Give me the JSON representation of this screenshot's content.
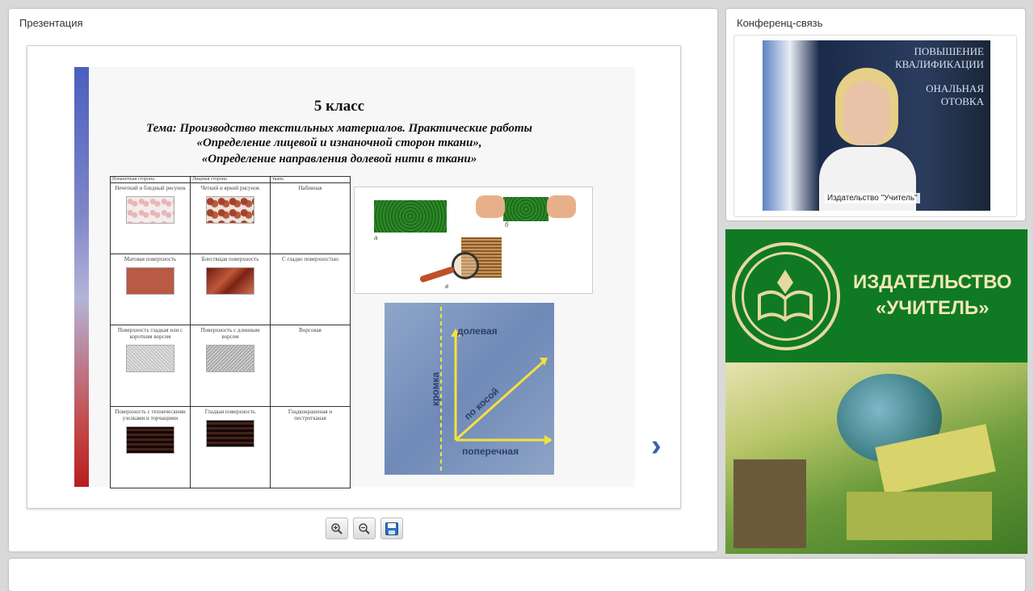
{
  "presentation_panel": {
    "title": "Презентация"
  },
  "slide": {
    "grade": "5 класс",
    "theme": "Тема:  Производство текстильных материалов. Практические работы",
    "work1": "«Определение лицевой и изнаночной сторон ткани»,",
    "work2": "«Определение направления долевой  нити в ткани»",
    "table": {
      "headers": [
        "Изнаночная сторона",
        "Лицевая сторона",
        "ткань"
      ],
      "rows": [
        [
          "Нечеткий и бледный рисунок",
          "Четкий и яркий рисунок",
          "Набивная"
        ],
        [
          "Матовая поверхность",
          "Блестящая поверхность",
          "С гладко поверхностью"
        ],
        [
          "Поверхность гладкая или с коротким ворсом",
          "Поверхность с длинным ворсом",
          "Ворсовая"
        ],
        [
          "Поверхность с техническими узелками и торчащими",
          "Гладкая поверхность",
          "Гладкокрашеная и пестротканая"
        ]
      ]
    },
    "image_labels": {
      "a": "а",
      "b": "б",
      "c": "в"
    },
    "grain_labels": {
      "lengthwise": "долевая",
      "edge": "кромка",
      "bias": "по косой",
      "crosswise": "поперечная"
    }
  },
  "toolbar": {
    "zoom_in_icon": "zoom-in-icon",
    "zoom_out_icon": "zoom-out-icon",
    "save_icon": "save-icon"
  },
  "conference_panel": {
    "title": "Конференц-связь",
    "video_caption": "Издательство \"Учитель\"",
    "banner_lines": [
      "ПОВЫШЕНИЕ",
      "КВАЛИФИКАЦИИ",
      "ОНАЛЬНАЯ",
      "ОТОВКА"
    ]
  },
  "publisher": {
    "name_line1": "ИЗДАТЕЛЬСТВО",
    "name_line2": "«УЧИТЕЛЬ»"
  },
  "colors": {
    "accent": "#3e5fb0",
    "publisher_green": "#0f7a23",
    "publisher_gold": "#f2e7b6"
  }
}
